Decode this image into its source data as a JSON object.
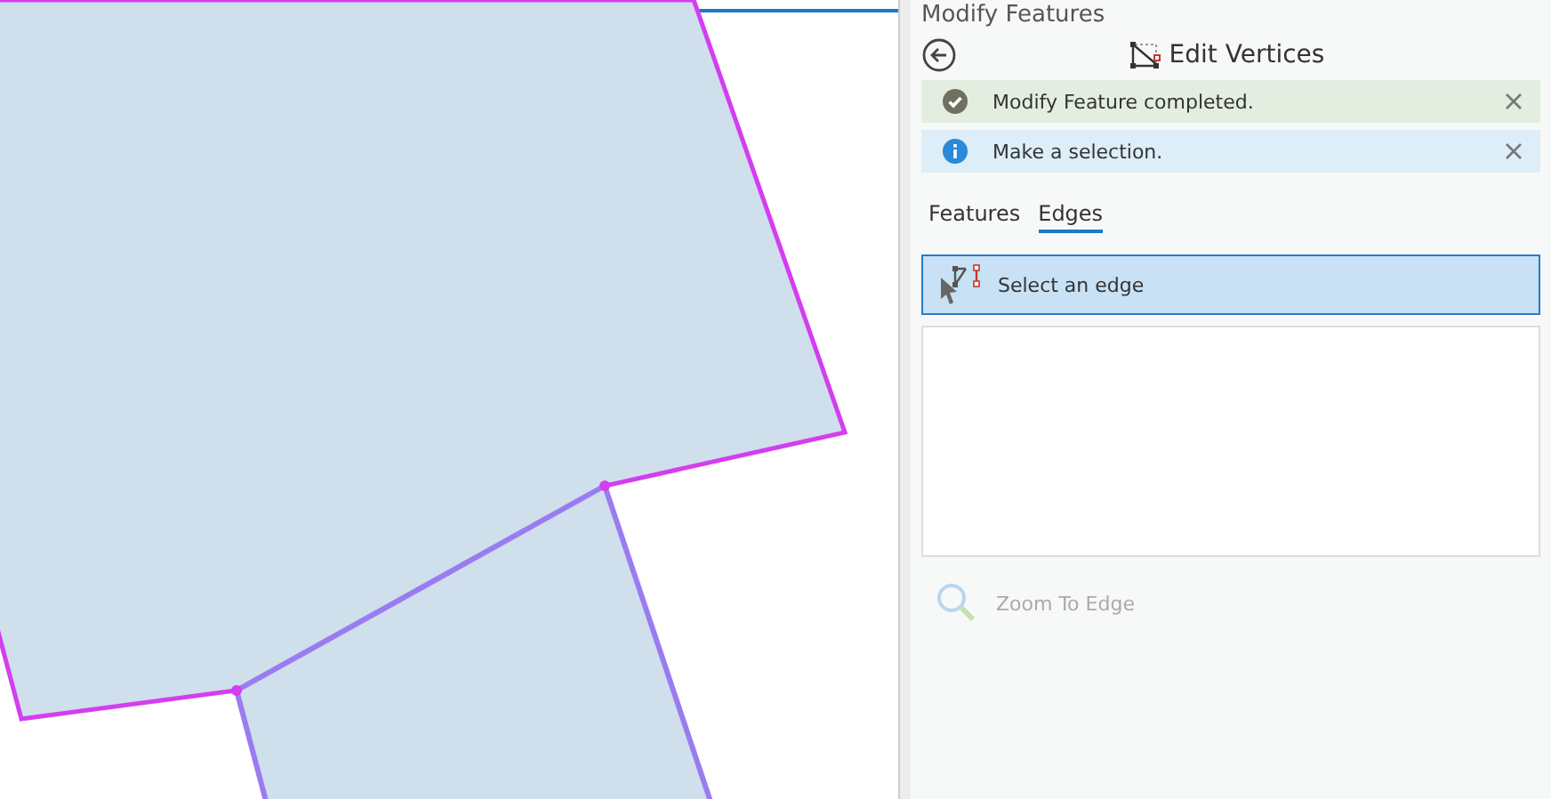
{
  "pane": {
    "title": "Modify Features"
  },
  "tool": {
    "title": "Edit Vertices"
  },
  "messages": [
    {
      "kind": "success",
      "text": "Modify Feature completed."
    },
    {
      "kind": "info",
      "text": "Make a selection."
    }
  ],
  "tabs": [
    {
      "label": "Features",
      "selected": false
    },
    {
      "label": "Edges",
      "selected": true
    }
  ],
  "select_button": {
    "label": "Select an edge",
    "selected": true
  },
  "zoom_button": {
    "label": "Zoom To Edge",
    "disabled": true
  }
}
